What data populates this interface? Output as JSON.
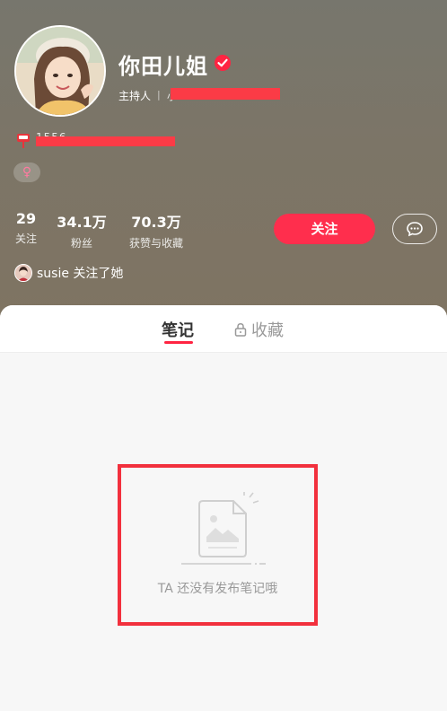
{
  "profile": {
    "nickname": "你田儿姐",
    "role": "主持人",
    "role_separator": "|",
    "role_extra": "小",
    "id_text": "1556",
    "gender_symbol": "♀"
  },
  "stats": [
    {
      "value": "29",
      "label": "关注"
    },
    {
      "value": "34.1万",
      "label": "粉丝"
    },
    {
      "value": "70.3万",
      "label": "获赞与收藏"
    }
  ],
  "actions": {
    "follow_label": "关注"
  },
  "mutual": {
    "text": "susie 关注了她"
  },
  "tabs": {
    "notes": "笔记",
    "collections": "收藏"
  },
  "empty_state": {
    "message": "TA 还没有发布笔记哦"
  },
  "colors": {
    "accent": "#ff2442",
    "redaction": "#fb3b46",
    "header_bg": "#7b7566"
  }
}
